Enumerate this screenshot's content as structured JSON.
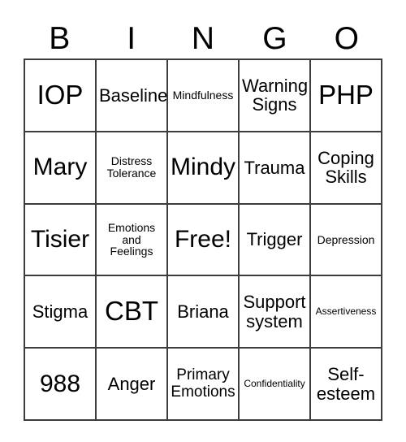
{
  "card": {
    "title": "BINGO",
    "headers": [
      "B",
      "I",
      "N",
      "G",
      "O"
    ],
    "background_color": "#ffffff",
    "border_color": "#3d3d3d",
    "text_color": "#000000",
    "rows": 5,
    "columns": 5,
    "cells": [
      [
        {
          "text": "IOP",
          "size": "fs-xl"
        },
        {
          "text": "Baseline",
          "size": "fs-md"
        },
        {
          "text": "Mindfulness",
          "size": "fs-xs"
        },
        {
          "text": "Warning\nSigns",
          "size": "fs-md"
        },
        {
          "text": "PHP",
          "size": "fs-xl"
        }
      ],
      [
        {
          "text": "Mary",
          "size": "fs-lg"
        },
        {
          "text": "Distress\nTolerance",
          "size": "fs-xs"
        },
        {
          "text": "Mindy",
          "size": "fs-lg"
        },
        {
          "text": "Trauma",
          "size": "fs-md"
        },
        {
          "text": "Coping\nSkills",
          "size": "fs-md"
        }
      ],
      [
        {
          "text": "Tisier",
          "size": "fs-lg"
        },
        {
          "text": "Emotions\nand\nFeelings",
          "size": "fs-xs"
        },
        {
          "text": "Free!",
          "size": "fs-lg"
        },
        {
          "text": "Trigger",
          "size": "fs-md"
        },
        {
          "text": "Depression",
          "size": "fs-xs"
        }
      ],
      [
        {
          "text": "Stigma",
          "size": "fs-md"
        },
        {
          "text": "CBT",
          "size": "fs-xl"
        },
        {
          "text": "Briana",
          "size": "fs-md"
        },
        {
          "text": "Support\nsystem",
          "size": "fs-md"
        },
        {
          "text": "Assertiveness",
          "size": "fs-xxs"
        }
      ],
      [
        {
          "text": "988",
          "size": "fs-lg"
        },
        {
          "text": "Anger",
          "size": "fs-md"
        },
        {
          "text": "Primary\nEmotions",
          "size": "fs-sm"
        },
        {
          "text": "Confidentiality",
          "size": "fs-xxs"
        },
        {
          "text": "Self-\nesteem",
          "size": "fs-md"
        }
      ]
    ]
  }
}
